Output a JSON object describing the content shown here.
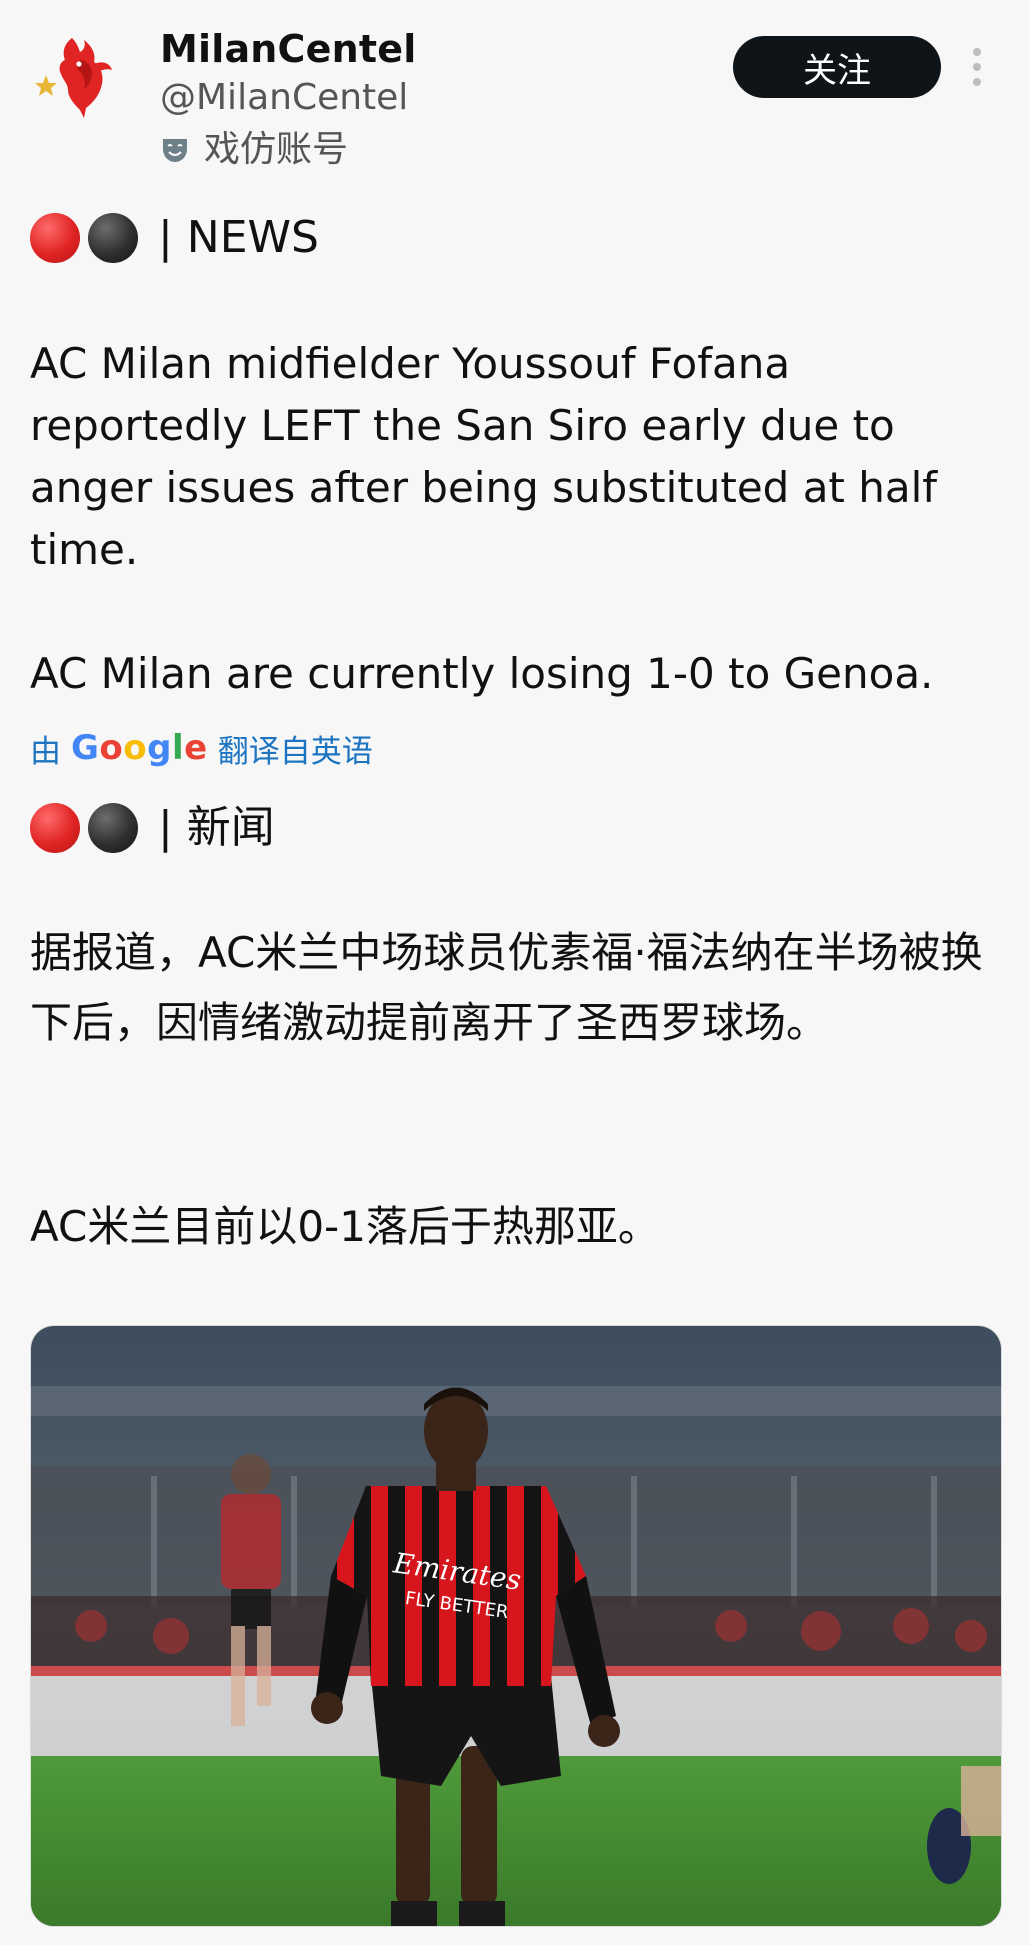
{
  "header": {
    "display_name": "MilanCentel",
    "handle": "@MilanCentel",
    "parody_label": "戏仿账号",
    "follow_label": "关注"
  },
  "post": {
    "news_tag": "| NEWS",
    "original_paragraphs": [
      "AC Milan midfielder Youssouf Fofana reportedly LEFT the San Siro early due to anger issues after being substituted at half time.",
      "AC Milan are currently losing 1-0 to Genoa."
    ],
    "translation": {
      "prefix": "由",
      "provider": "Google",
      "suffix": "翻译自英语"
    },
    "translated_tag": "| 新闻",
    "translated_paragraphs": [
      "据报道，AC米兰中场球员优素福·福法纳在半场被换下后，因情绪激动提前离开了圣西罗球场。",
      "AC米兰目前以0-1落后于热那亚。"
    ],
    "media": {
      "jersey_text_1": "Emirates",
      "jersey_text_2": "FLY BETTER"
    }
  },
  "icons": {
    "avatar": "ac-milan-devil-logo",
    "parody": "theater-mask-icon",
    "more": "more-vertical-icon",
    "dots": [
      "red-circle",
      "black-circle"
    ]
  },
  "colors": {
    "follow_button": "#0f1419",
    "translate_link": "#1d75c2",
    "milan_red": "#e02424"
  }
}
